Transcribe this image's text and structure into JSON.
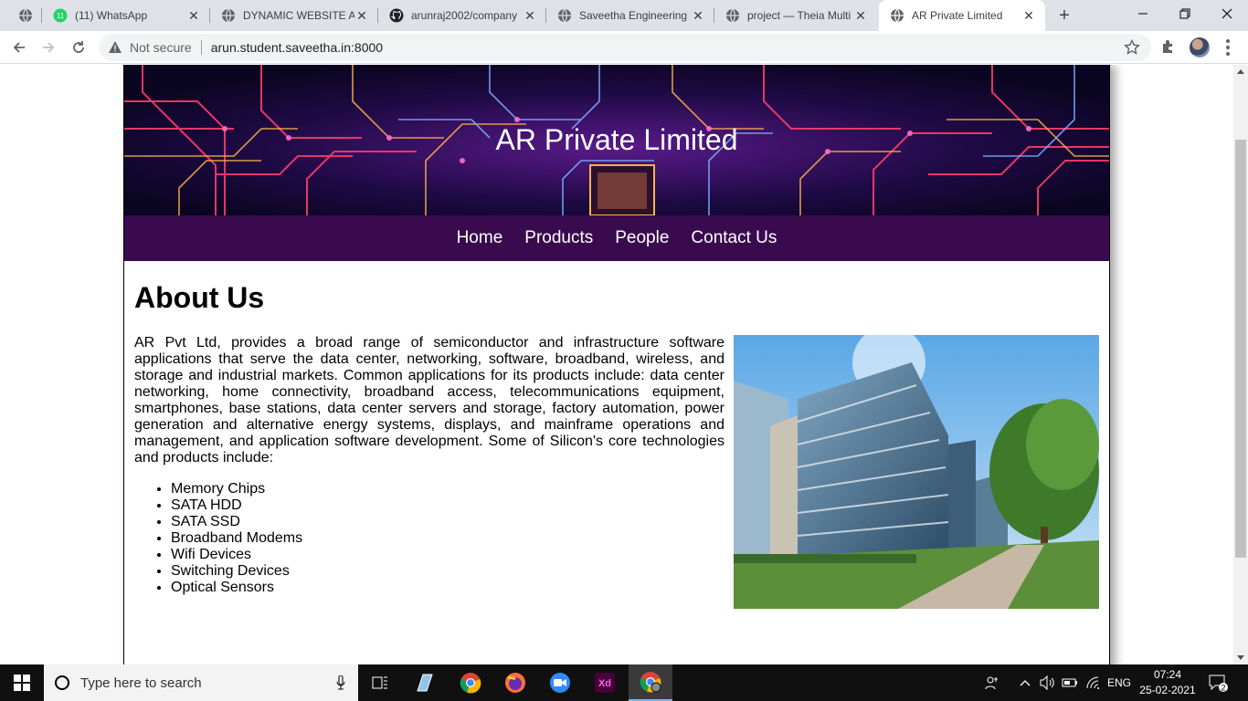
{
  "tabs": [
    {
      "title": "",
      "icon": "globe-icon"
    },
    {
      "title": "(11) WhatsApp",
      "icon": "whatsapp-icon",
      "badge": "11"
    },
    {
      "title": "DYNAMIC WEBSITE AR",
      "icon": "globe-icon"
    },
    {
      "title": "arunraj2002/company",
      "icon": "github-icon"
    },
    {
      "title": "Saveetha Engineering",
      "icon": "globe-icon"
    },
    {
      "title": "project — Theia Multi",
      "icon": "globe-icon"
    },
    {
      "title": "AR Private Limited",
      "icon": "globe-icon",
      "active": true
    }
  ],
  "address_bar": {
    "security_label": "Not secure",
    "url": "arun.student.saveetha.in:8000"
  },
  "site": {
    "title": "AR Private Limited",
    "nav": [
      "Home",
      "Products",
      "People",
      "Contact Us"
    ],
    "heading": "About Us",
    "paragraph": "AR Pvt Ltd, provides a broad range of semiconductor and infrastructure software applications that serve the data center, networking, software, broadband, wireless, and storage and industrial markets. Common applications for its products include: data center networking, home connectivity, broadband access, telecommunications equipment, smartphones, base stations, data center servers and storage, factory automation, power generation and alternative energy systems, displays, and mainframe operations and management, and application software development. Some of Silicon's core technologies and products include:",
    "products": [
      "Memory Chips",
      "SATA HDD",
      "SATA SSD",
      "Broadband Modems",
      "Wifi Devices",
      "Switching Devices",
      "Optical Sensors"
    ]
  },
  "taskbar": {
    "search_placeholder": "Type here to search",
    "language": "ENG",
    "time": "07:24",
    "date": "25-02-2021",
    "notification_count": "2",
    "apps": [
      "task-view",
      "paint-3d",
      "chrome",
      "firefox",
      "zoom",
      "adobe-xd",
      "chrome-profile"
    ]
  },
  "colors": {
    "nav_bg": "#3a0a4e",
    "tab_strip": "#dee1e6",
    "taskbar": "#101010"
  }
}
